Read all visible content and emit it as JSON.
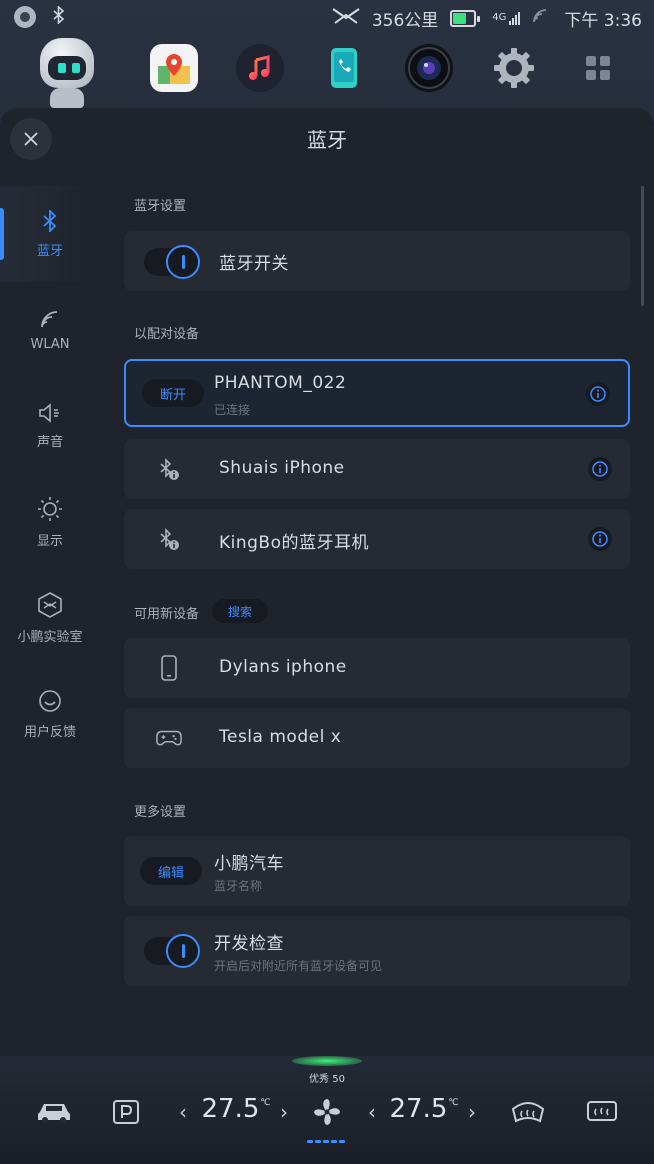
{
  "status_bar": {
    "range": "356公里",
    "network": "4G",
    "time": "下午 3:36"
  },
  "dock": {
    "apps": [
      "robot-assistant",
      "map",
      "music",
      "phone",
      "camera",
      "settings",
      "apps-grid"
    ]
  },
  "panel": {
    "title": "蓝牙"
  },
  "sidebar": {
    "items": [
      {
        "label": "蓝牙",
        "icon": "bluetooth-icon",
        "active": true
      },
      {
        "label": "WLAN",
        "icon": "wifi-icon"
      },
      {
        "label": "声音",
        "icon": "speaker-icon"
      },
      {
        "label": "显示",
        "icon": "brightness-icon"
      },
      {
        "label": "小鹏实验室",
        "icon": "lab-icon"
      },
      {
        "label": "用户反馈",
        "icon": "smile-icon"
      }
    ]
  },
  "bluetooth": {
    "settings_label": "蓝牙设置",
    "switch_label": "蓝牙开关",
    "paired_label": "以配对设备",
    "paired": [
      {
        "action": "断开",
        "name": "PHANTOM_022",
        "status": "已连接"
      },
      {
        "name": "Shuais iPhone"
      },
      {
        "name": "KingBo的蓝牙耳机"
      }
    ],
    "available_label": "可用新设备",
    "search_label": "搜索",
    "available": [
      {
        "name": "Dylans iphone",
        "icon": "phone-icon"
      },
      {
        "name": "Tesla model x",
        "icon": "gamepad-icon"
      }
    ],
    "more_label": "更多设置",
    "edit_label": "编辑",
    "device_name": "小鹏汽车",
    "device_name_sub": "蓝牙名称",
    "dev_check_label": "开发检查",
    "dev_check_sub": "开启后对附近所有蓝牙设备可见"
  },
  "climate": {
    "eco": "优秀 50",
    "left_temp": "27.5",
    "right_temp": "27.5",
    "unit": "℃",
    "colors": {
      "accent": "#3a8cff",
      "eco": "#3ef07a"
    }
  }
}
